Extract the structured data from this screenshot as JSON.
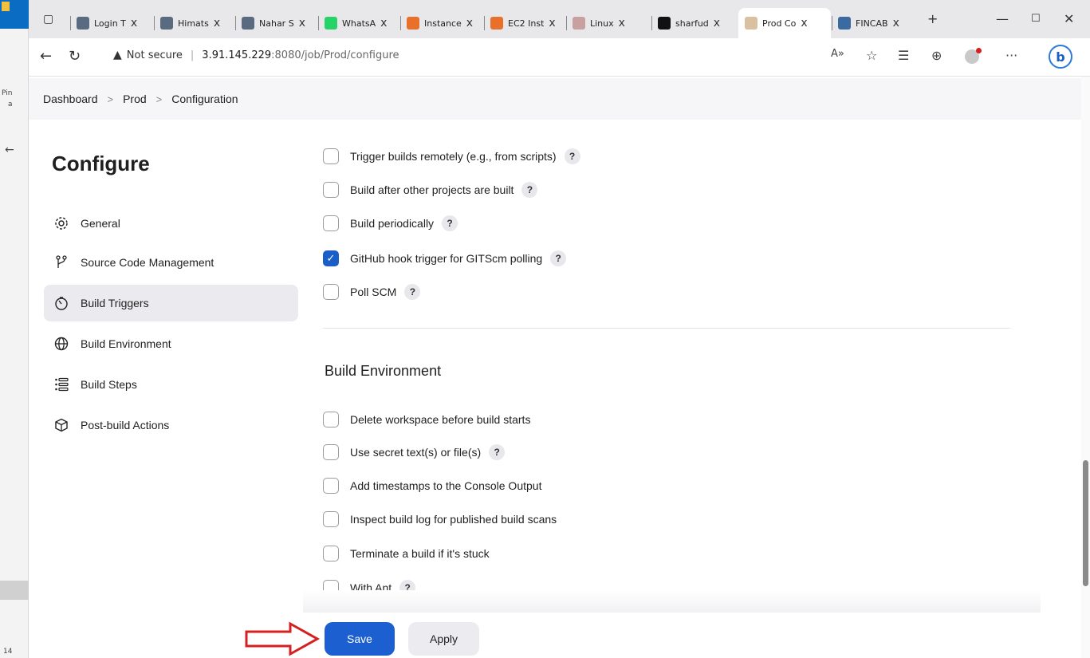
{
  "browser": {
    "tabs": [
      {
        "title": "Login T",
        "icon": "jenkins-terminal-icon",
        "color": "#5a6a80"
      },
      {
        "title": "Himats",
        "icon": "jenkins-terminal-icon",
        "color": "#5a6a80"
      },
      {
        "title": "Nahar S",
        "icon": "jenkins-terminal-icon",
        "color": "#5a6a80"
      },
      {
        "title": "WhatsA",
        "icon": "whatsapp-icon",
        "color": "#25d366"
      },
      {
        "title": "Instance",
        "icon": "aws-icon",
        "color": "#e8702a"
      },
      {
        "title": "EC2 Inst",
        "icon": "aws-cube-icon",
        "color": "#e8702a"
      },
      {
        "title": "Linux",
        "icon": "linux-icon",
        "color": "#c9a0a0"
      },
      {
        "title": "sharfud",
        "icon": "github-icon",
        "color": "#111111"
      },
      {
        "title": "Prod Co",
        "icon": "jenkins-icon",
        "color": "#d8c0a0",
        "active": true
      },
      {
        "title": "FINCAB",
        "icon": "fincab-icon",
        "color": "#3a6aa0"
      }
    ],
    "new_tab": "+",
    "window_controls": {
      "minimize": "—",
      "maximize": "☐",
      "close": "✕"
    },
    "address": {
      "warning": "Not secure",
      "host": "3.91.145.229",
      "path": ":8080/job/Prod/configure"
    }
  },
  "outer_window": {
    "pin_label": "Pin",
    "sub_label": "a",
    "bottom_label": "14"
  },
  "breadcrumb": [
    "Dashboard",
    "Prod",
    "Configuration"
  ],
  "sidebar": {
    "title": "Configure",
    "items": [
      {
        "label": "General",
        "icon": "gear-icon"
      },
      {
        "label": "Source Code Management",
        "icon": "git-branch-icon"
      },
      {
        "label": "Build Triggers",
        "icon": "timer-icon",
        "active": true
      },
      {
        "label": "Build Environment",
        "icon": "globe-icon"
      },
      {
        "label": "Build Steps",
        "icon": "list-icon"
      },
      {
        "label": "Post-build Actions",
        "icon": "package-icon"
      }
    ]
  },
  "triggers": [
    {
      "label": "Trigger builds remotely (e.g., from scripts)",
      "checked": false,
      "help": true
    },
    {
      "label": "Build after other projects are built",
      "checked": false,
      "help": true
    },
    {
      "label": "Build periodically",
      "checked": false,
      "help": true
    },
    {
      "label": "GitHub hook trigger for GITScm polling",
      "checked": true,
      "help": true
    },
    {
      "label": "Poll SCM",
      "checked": false,
      "help": true
    }
  ],
  "build_environment": {
    "title": "Build Environment",
    "options": [
      {
        "label": "Delete workspace before build starts",
        "checked": false,
        "help": false
      },
      {
        "label": "Use secret text(s) or file(s)",
        "checked": false,
        "help": true
      },
      {
        "label": "Add timestamps to the Console Output",
        "checked": false,
        "help": false
      },
      {
        "label": "Inspect build log for published build scans",
        "checked": false,
        "help": false
      },
      {
        "label": "Terminate a build if it's stuck",
        "checked": false,
        "help": false
      },
      {
        "label": "With Ant",
        "checked": false,
        "help": true
      }
    ]
  },
  "help_glyph": "?",
  "check_glyph": "✓",
  "actions": {
    "save": "Save",
    "apply": "Apply"
  },
  "colors": {
    "accent": "#1b5fd0",
    "arrow": "#d42020"
  }
}
